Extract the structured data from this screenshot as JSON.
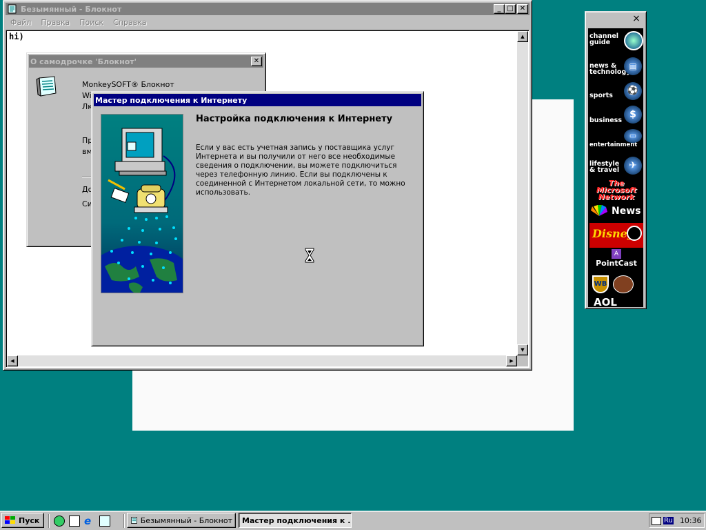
{
  "notepad": {
    "title": "Безымянный - Блокнот",
    "menu": [
      "Файл",
      "Правка",
      "Поиск",
      "Справка"
    ],
    "content": "hi)"
  },
  "about": {
    "title": "О самодрочке 'Блокнот'",
    "line1": "MonkeySOFT® Блокнот",
    "line2": "Wi",
    "line3": "Лк",
    "line4": "Пр",
    "line5": "вм",
    "line6": "До",
    "line7": "Си"
  },
  "wizard": {
    "title": "Мастер подключения к Интернету",
    "heading": "Настройка подключения к Интернету",
    "body": "Если у вас есть учетная запись у поставщика услуг Интернета и вы получили от него все необходимые сведения о подключении, вы можете подключиться через телефонную линию. Если вы подключены к соединенной с Интернетом локальной сети, то можно использовать."
  },
  "channel_bar": {
    "close": "×",
    "channels": [
      {
        "label": "channel guide",
        "icon": "magnifier-icon"
      },
      {
        "label": "news & technology",
        "icon": "newspaper-icon"
      },
      {
        "label": "sports",
        "icon": "ball-icon"
      },
      {
        "label": "business",
        "icon": "dollar-icon"
      },
      {
        "label": "entertainment",
        "icon": "tv-icon"
      },
      {
        "label": "lifestyle & travel",
        "icon": "airplane-icon"
      }
    ],
    "logos": {
      "msn": "The Microsoft Network",
      "msnbc": "News",
      "disney": "Disney",
      "pointcast": "PointCast",
      "aol": "AOL"
    }
  },
  "taskbar": {
    "start": "Пуск",
    "tasks": [
      {
        "label": "Безымянный - Блокнот"
      },
      {
        "label": "Мастер подключения к ..."
      }
    ],
    "tray": {
      "lang": "Ru",
      "time": "10:36"
    }
  },
  "colors": {
    "desktop": "#008080",
    "active_title": "#000080",
    "inactive_title": "#808080"
  }
}
